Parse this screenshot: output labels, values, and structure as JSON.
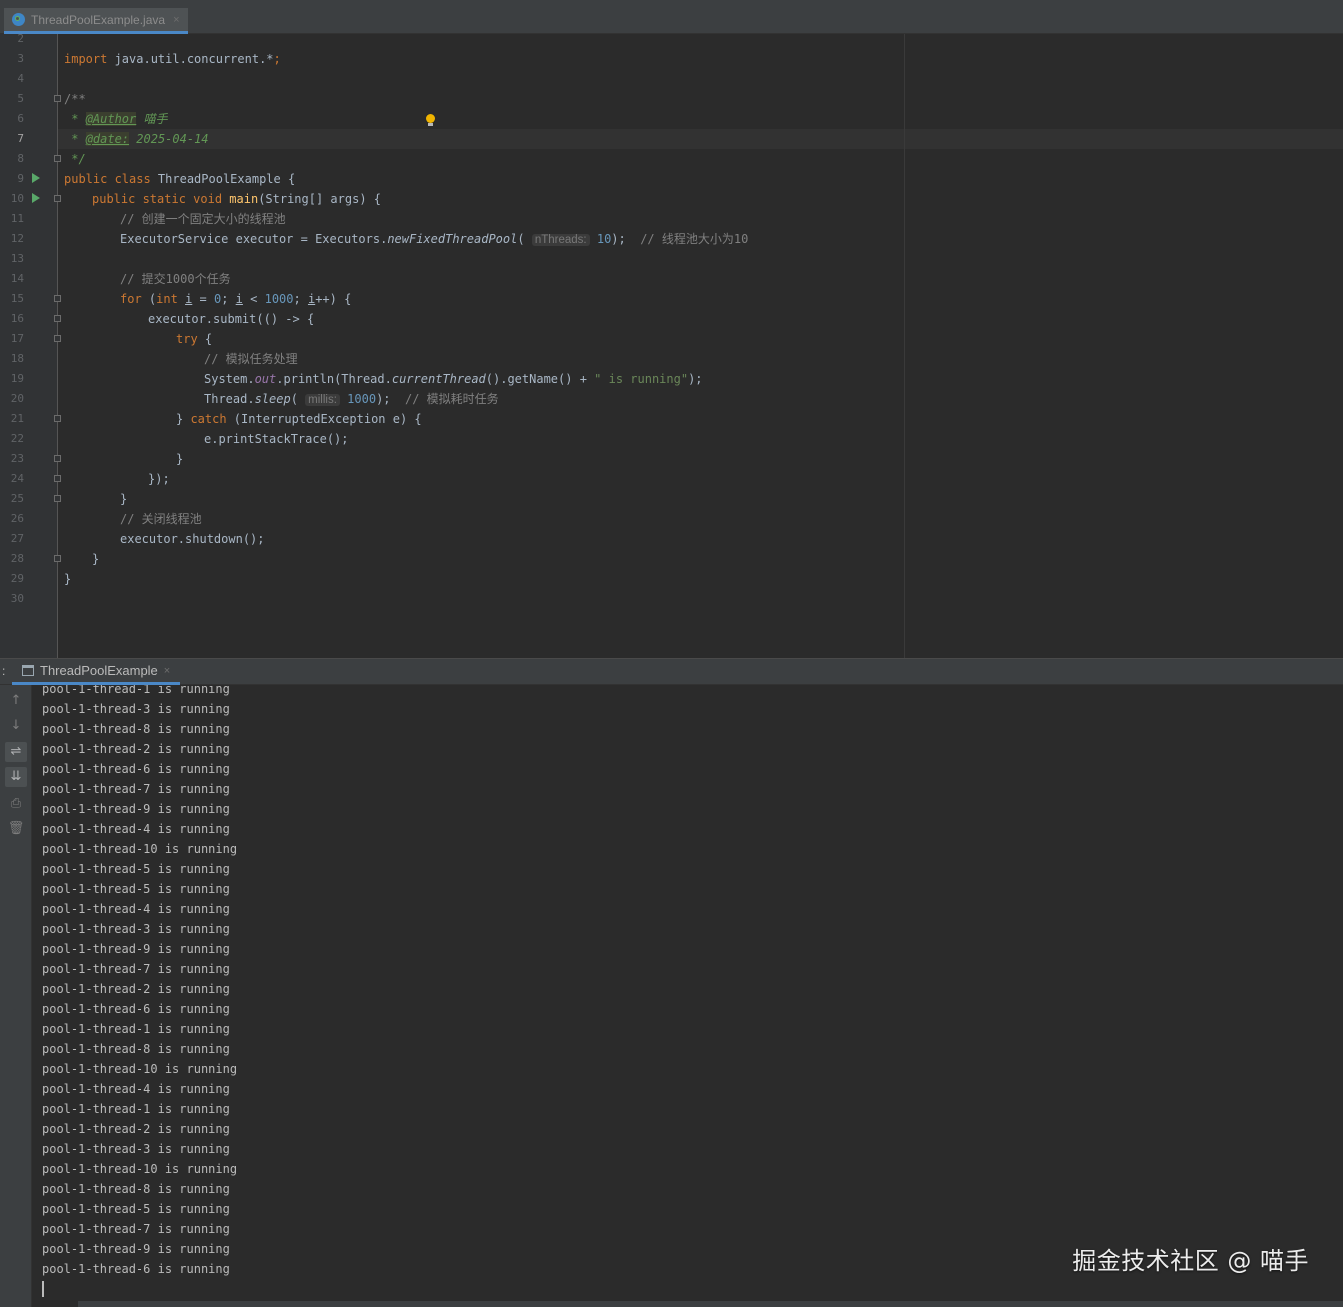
{
  "editor_tab": {
    "label": "ThreadPoolExample.java",
    "close": "×"
  },
  "code": {
    "line_numbers": [
      "2",
      "3",
      "4",
      "5",
      "6",
      "7",
      "8",
      "9",
      "10",
      "11",
      "12",
      "13",
      "14",
      "15",
      "16",
      "17",
      "18",
      "19",
      "20",
      "21",
      "22",
      "23",
      "24",
      "25",
      "26",
      "27",
      "28",
      "29",
      "30"
    ],
    "l3": {
      "kw": "import",
      "rest": " java.util.concurrent.*",
      "semi": ";"
    },
    "l5": "/**",
    "l6": {
      "star": " * ",
      "tag": "@Author",
      "val": " 喵手"
    },
    "l7": {
      "star": " * ",
      "tag": "@date:",
      "val": " 2025-04-14"
    },
    "l8": " */",
    "l9": {
      "kw": "public class",
      "name": " ThreadPoolExample {"
    },
    "l10": {
      "kw": "public static void",
      "fn": "main",
      "rest": "(String[] args) {"
    },
    "l11": "// 创建一个固定大小的线程池",
    "l12": {
      "a": "ExecutorService executor = Executors.",
      "fn": "newFixedThreadPool",
      "b": "(",
      "hint": "nThreads:",
      "num": "10",
      "c": ");",
      "cm": "// 线程池大小为10"
    },
    "l14": "// 提交1000个任务",
    "l15": {
      "kw": "for",
      "a": " (",
      "kw2": "int",
      "b": " ",
      "i1": "i",
      "c": " = ",
      "n0": "0",
      "d": "; ",
      "i2": "i",
      "e": " < ",
      "n1": "1000",
      "f": "; ",
      "i3": "i",
      "g": "++) {"
    },
    "l16": "executor.submit(() -> {",
    "l17": {
      "kw": "try",
      "rest": " {"
    },
    "l18": "// 模拟任务处理",
    "l19": {
      "a": "System.",
      "field": "out",
      "b": ".println(Thread.",
      "it": "currentThread",
      "c": "().getName() + ",
      "str": "\" is running\"",
      "d": ");"
    },
    "l20": {
      "a": "Thread.",
      "it": "sleep",
      "b": "(",
      "hint": "millis:",
      "num": "1000",
      "c": ");",
      "cm": "// 模拟耗时任务"
    },
    "l21": {
      "a": "} ",
      "kw": "catch",
      "b": " (InterruptedException e) {"
    },
    "l22": "e.printStackTrace();",
    "l23": "}",
    "l24": "});",
    "l25": "}",
    "l26": "// 关闭线程池",
    "l27": "executor.shutdown();",
    "l28": "}",
    "l29": "}"
  },
  "run_window": {
    "colon": ":",
    "tab_label": "ThreadPoolExample",
    "tab_close": "×",
    "toolbar": [
      "↑",
      "↓",
      "⇌",
      "⇊",
      "⎙",
      "🗑"
    ]
  },
  "console_lines": [
    "pool-1-thread-1 is running",
    "pool-1-thread-3 is running",
    "pool-1-thread-8 is running",
    "pool-1-thread-2 is running",
    "pool-1-thread-6 is running",
    "pool-1-thread-7 is running",
    "pool-1-thread-9 is running",
    "pool-1-thread-4 is running",
    "pool-1-thread-10 is running",
    "pool-1-thread-5 is running",
    "pool-1-thread-5 is running",
    "pool-1-thread-4 is running",
    "pool-1-thread-3 is running",
    "pool-1-thread-9 is running",
    "pool-1-thread-7 is running",
    "pool-1-thread-2 is running",
    "pool-1-thread-6 is running",
    "pool-1-thread-1 is running",
    "pool-1-thread-8 is running",
    "pool-1-thread-10 is running",
    "pool-1-thread-4 is running",
    "pool-1-thread-1 is running",
    "pool-1-thread-2 is running",
    "pool-1-thread-3 is running",
    "pool-1-thread-10 is running",
    "pool-1-thread-8 is running",
    "pool-1-thread-5 is running",
    "pool-1-thread-7 is running",
    "pool-1-thread-9 is running",
    "pool-1-thread-6 is running"
  ],
  "watermark": "掘金技术社区 @ 喵手"
}
